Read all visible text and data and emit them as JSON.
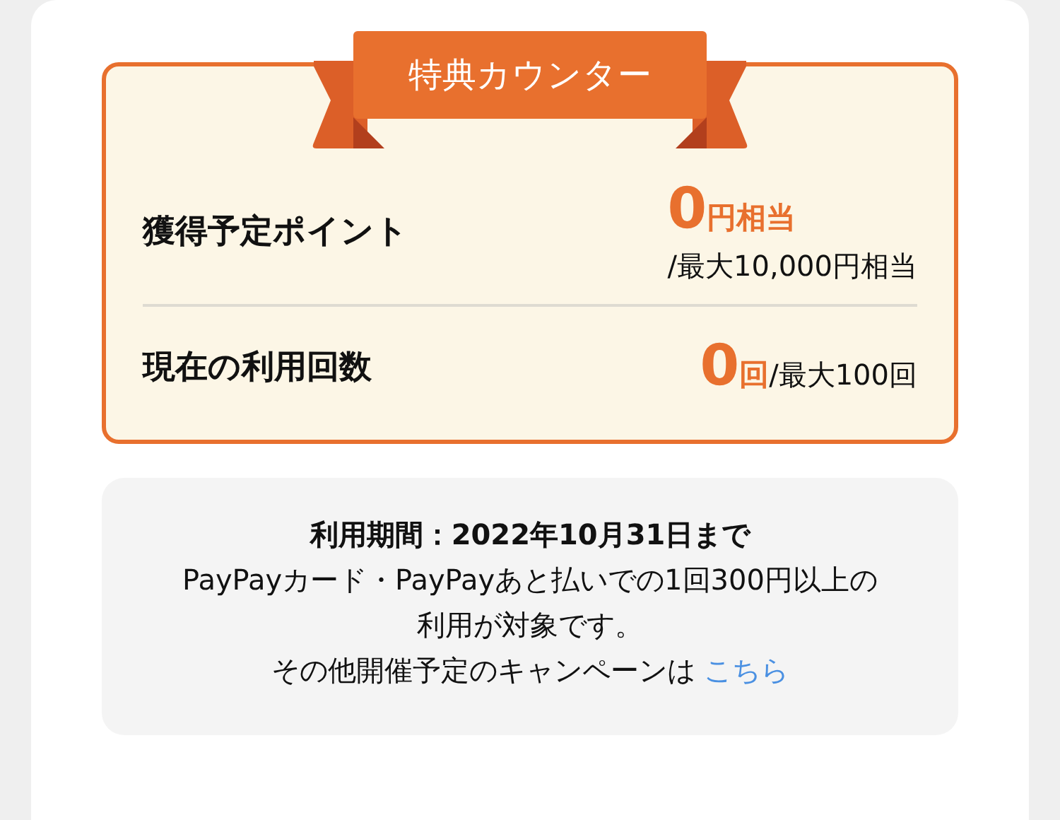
{
  "counter": {
    "title": "特典カウンター",
    "rows": [
      {
        "kind": "stacked",
        "label": "獲得予定ポイント",
        "value": "0",
        "unit": "円相当",
        "max": "/最大10,000円相当"
      },
      {
        "kind": "inline",
        "label": "現在の利用回数",
        "value": "0",
        "unit": "回",
        "max": "/最大100回"
      }
    ]
  },
  "info": {
    "period": "利用期間：2022年10月31日まで",
    "note": "PayPayカード・PayPayあと払いでの1回300円以上の利用が対象です。",
    "more": "その他開催予定のキャンペーンは",
    "link": "こちら"
  }
}
